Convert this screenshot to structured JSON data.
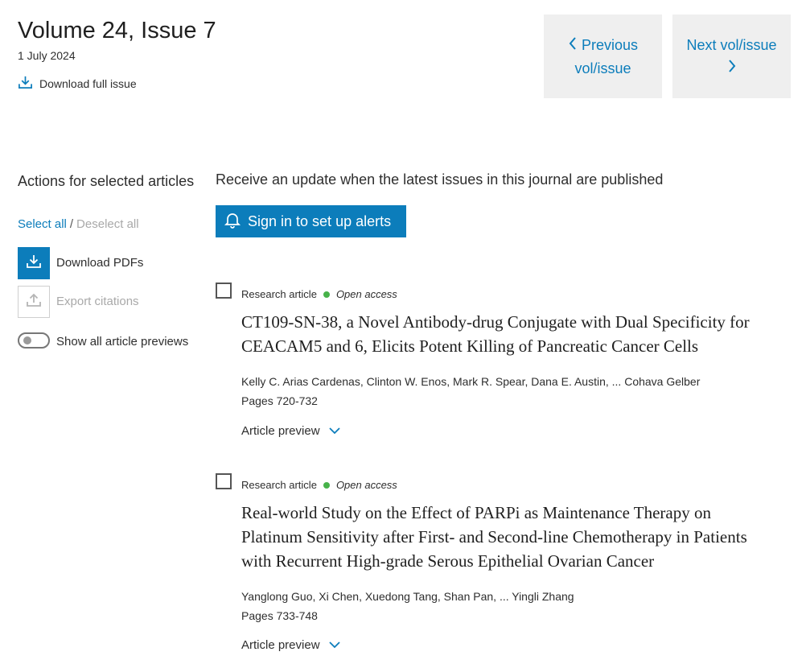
{
  "issue": {
    "title": "Volume 24, Issue 7",
    "date": "1 July 2024",
    "download_full_issue": "Download full issue"
  },
  "nav": {
    "previous_line1": "Previous",
    "previous_line2": "vol/issue",
    "next_label": "Next vol/issue"
  },
  "actions": {
    "title": "Actions for selected articles",
    "select_all": "Select all",
    "separator": "/",
    "deselect_all": "Deselect all",
    "download_pdfs": "Download PDFs",
    "export_citations": "Export citations",
    "show_previews": "Show all article previews"
  },
  "alerts": {
    "text": "Receive an update when the latest issues in this journal are published",
    "signin_label": "Sign in to set up alerts"
  },
  "articles": [
    {
      "type": "Research article",
      "access": "Open access",
      "title_line1": "CT109-SN-38, a Novel Antibody-drug Conjugate with Dual Specificity for",
      "title_line2": "CEACAM5 and 6, Elicits Potent Killing of Pancreatic Cancer Cells",
      "authors": "Kelly C. Arias Cardenas, Clinton W. Enos, Mark R. Spear, Dana E. Austin, ... Cohava Gelber",
      "pages": "Pages 720-732",
      "preview": "Article preview"
    },
    {
      "type": "Research article",
      "access": "Open access",
      "title_line1": "Real-world Study on the Effect of PARPi as Maintenance Therapy on",
      "title_line2": "Platinum Sensitivity after First- and Second-line Chemotherapy in Patients",
      "title_line3": "with Recurrent High-grade Serous Epithelial Ovarian Cancer",
      "authors": "Yanglong Guo, Xi Chen, Xuedong Tang, Shan Pan, ... Yingli Zhang",
      "pages": "Pages 733-748",
      "preview": "Article preview"
    }
  ],
  "colors": {
    "accent": "#0c7dbb",
    "open_access_dot": "#47b24a",
    "nav_background": "#efefef",
    "disabled_text": "#a9a9a9"
  },
  "icons": [
    "download-icon",
    "chevron-left-icon",
    "chevron-right-icon",
    "upload-icon",
    "bell-icon",
    "chevron-down-icon"
  ]
}
